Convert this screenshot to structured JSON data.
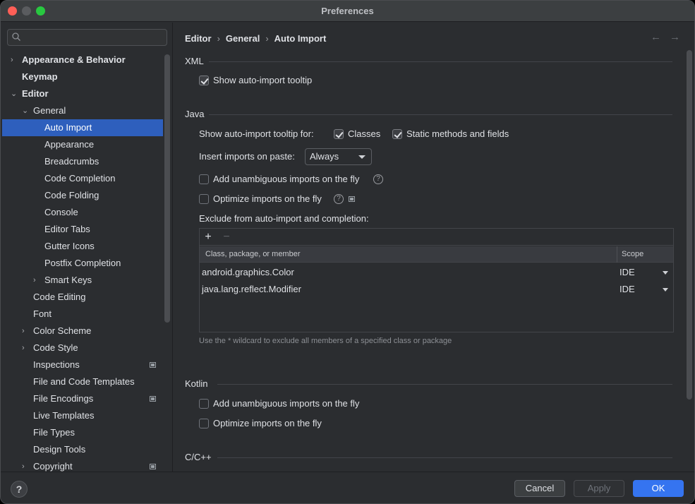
{
  "window": {
    "title": "Preferences"
  },
  "sidebar": {
    "search_placeholder": "",
    "items": [
      {
        "label": "Appearance & Behavior"
      },
      {
        "label": "Keymap"
      },
      {
        "label": "Editor"
      },
      {
        "label": "General"
      },
      {
        "label": "Auto Import"
      },
      {
        "label": "Appearance"
      },
      {
        "label": "Breadcrumbs"
      },
      {
        "label": "Code Completion"
      },
      {
        "label": "Code Folding"
      },
      {
        "label": "Console"
      },
      {
        "label": "Editor Tabs"
      },
      {
        "label": "Gutter Icons"
      },
      {
        "label": "Postfix Completion"
      },
      {
        "label": "Smart Keys"
      },
      {
        "label": "Code Editing"
      },
      {
        "label": "Font"
      },
      {
        "label": "Color Scheme"
      },
      {
        "label": "Code Style"
      },
      {
        "label": "Inspections"
      },
      {
        "label": "File and Code Templates"
      },
      {
        "label": "File Encodings"
      },
      {
        "label": "Live Templates"
      },
      {
        "label": "File Types"
      },
      {
        "label": "Design Tools"
      },
      {
        "label": "Copyright"
      }
    ]
  },
  "breadcrumb": [
    "Editor",
    "General",
    "Auto Import"
  ],
  "xml": {
    "title": "XML",
    "show_tooltip": {
      "label": "Show auto-import tooltip",
      "checked": true
    }
  },
  "java": {
    "title": "Java",
    "tooltip_for_label": "Show auto-import tooltip for:",
    "classes": {
      "label": "Classes",
      "checked": true
    },
    "static_methods": {
      "label": "Static methods and fields",
      "checked": true
    },
    "insert_on_paste_label": "Insert imports on paste:",
    "insert_on_paste_value": "Always",
    "add_unambiguous": {
      "label": "Add unambiguous imports on the fly",
      "checked": false
    },
    "optimize": {
      "label": "Optimize imports on the fly",
      "checked": false
    },
    "exclude_label": "Exclude from auto-import and completion:",
    "table": {
      "add": "+",
      "remove": "−",
      "headers": [
        "Class, package, or member",
        "Scope"
      ],
      "rows": [
        {
          "name": "android.graphics.Color",
          "scope": "IDE"
        },
        {
          "name": "java.lang.reflect.Modifier",
          "scope": "IDE"
        }
      ]
    },
    "hint": "Use the * wildcard to exclude all members of a specified class or package"
  },
  "kotlin": {
    "title": "Kotlin",
    "add_unambiguous": {
      "label": "Add unambiguous imports on the fly",
      "checked": false
    },
    "optimize": {
      "label": "Optimize imports on the fly",
      "checked": false
    }
  },
  "cpp": {
    "title": "C/C++"
  },
  "footer": {
    "help": "?",
    "cancel": "Cancel",
    "apply": "Apply",
    "ok": "OK"
  },
  "colors": {
    "selection": "#2e5fbd",
    "primary": "#3574f0",
    "background": "#2b2d30"
  }
}
